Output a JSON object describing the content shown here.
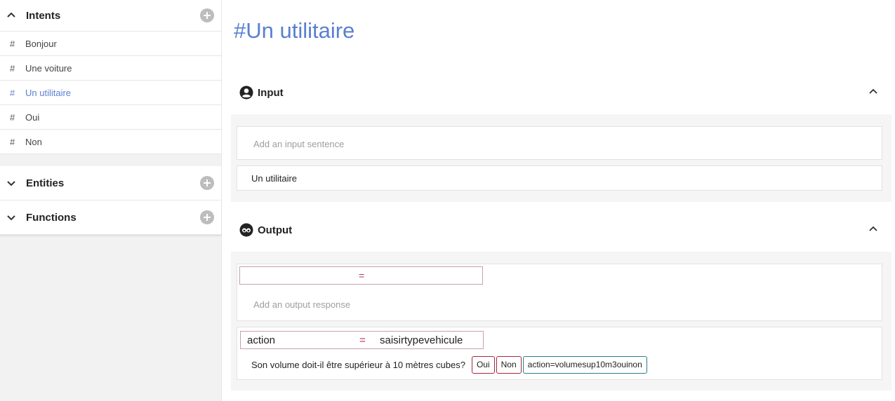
{
  "sidebar": {
    "intents": {
      "title": "Intents",
      "items": [
        {
          "label": "Bonjour"
        },
        {
          "label": "Une voiture"
        },
        {
          "label": "Un utilitaire"
        },
        {
          "label": "Oui"
        },
        {
          "label": "Non"
        }
      ],
      "hash": "#"
    },
    "entities": {
      "title": "Entities"
    },
    "functions": {
      "title": "Functions"
    }
  },
  "main": {
    "title": "#Un utilitaire",
    "input_panel": {
      "title": "Input",
      "placeholder": "Add an input sentence",
      "sentences": [
        "Un utilitaire"
      ]
    },
    "output_panel": {
      "title": "Output",
      "new_kv": {
        "key": "",
        "eq": "=",
        "value": ""
      },
      "placeholder": "Add an output response",
      "response": {
        "kv": {
          "key": "action",
          "eq": "=",
          "value": "saisirtypevehicule"
        },
        "text": "Son volume doit-il être supérieur à 10 mètres cubes?",
        "tags": [
          "Oui",
          "Non",
          "action=volumesup10m3ouinon"
        ]
      }
    }
  },
  "colors": {
    "accent": "#5a7fd1",
    "tag_red": "#a4283f",
    "tag_teal": "#2a7f8a"
  }
}
